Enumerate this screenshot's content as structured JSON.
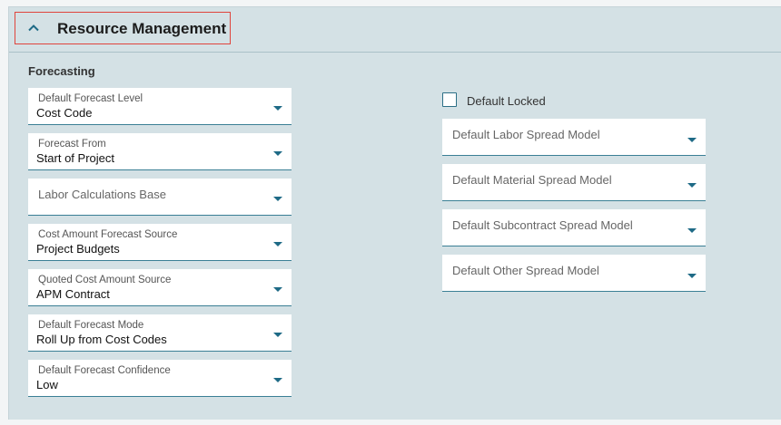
{
  "section": {
    "title": "Resource Management",
    "subsection": "Forecasting"
  },
  "left_fields": [
    {
      "label": "Default Forecast Level",
      "value": "Cost Code"
    },
    {
      "label": "Forecast From",
      "value": "Start of Project"
    },
    {
      "label": "Labor Calculations Base",
      "value": ""
    },
    {
      "label": "Cost Amount Forecast Source",
      "value": "Project Budgets"
    },
    {
      "label": "Quoted Cost Amount Source",
      "value": "APM Contract"
    },
    {
      "label": "Default Forecast Mode",
      "value": "Roll Up from Cost Codes"
    },
    {
      "label": "Default Forecast Confidence",
      "value": "Low"
    }
  ],
  "default_locked": {
    "label": "Default Locked",
    "checked": false
  },
  "right_fields": [
    {
      "label": "Default Labor Spread Model",
      "value": ""
    },
    {
      "label": "Default Material Spread Model",
      "value": ""
    },
    {
      "label": "Default Subcontract Spread Model",
      "value": ""
    },
    {
      "label": "Default Other Spread Model",
      "value": ""
    }
  ],
  "colors": {
    "panel_bg": "#d4e1e5",
    "accent": "#1e6a86",
    "highlight_border": "#e0443c"
  }
}
